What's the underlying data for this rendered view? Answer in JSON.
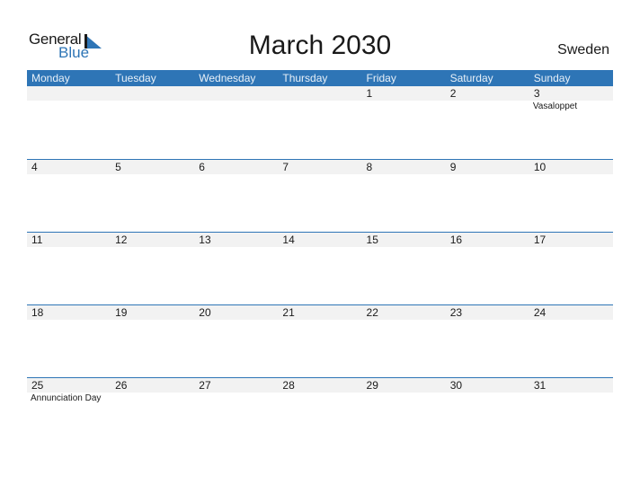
{
  "logo": {
    "general": "General",
    "blue": "Blue",
    "accent": "#2e75b6"
  },
  "title": "March 2030",
  "country": "Sweden",
  "weekdays": [
    "Monday",
    "Tuesday",
    "Wednesday",
    "Thursday",
    "Friday",
    "Saturday",
    "Sunday"
  ],
  "weeks": [
    [
      {
        "day": ""
      },
      {
        "day": ""
      },
      {
        "day": ""
      },
      {
        "day": ""
      },
      {
        "day": "1"
      },
      {
        "day": "2"
      },
      {
        "day": "3",
        "holiday": "Vasaloppet"
      }
    ],
    [
      {
        "day": "4"
      },
      {
        "day": "5"
      },
      {
        "day": "6"
      },
      {
        "day": "7"
      },
      {
        "day": "8"
      },
      {
        "day": "9"
      },
      {
        "day": "10"
      }
    ],
    [
      {
        "day": "11"
      },
      {
        "day": "12"
      },
      {
        "day": "13"
      },
      {
        "day": "14"
      },
      {
        "day": "15"
      },
      {
        "day": "16"
      },
      {
        "day": "17"
      }
    ],
    [
      {
        "day": "18"
      },
      {
        "day": "19"
      },
      {
        "day": "20"
      },
      {
        "day": "21"
      },
      {
        "day": "22"
      },
      {
        "day": "23"
      },
      {
        "day": "24"
      }
    ],
    [
      {
        "day": "25",
        "holiday": "Annunciation Day"
      },
      {
        "day": "26"
      },
      {
        "day": "27"
      },
      {
        "day": "28"
      },
      {
        "day": "29"
      },
      {
        "day": "30"
      },
      {
        "day": "31"
      }
    ]
  ]
}
